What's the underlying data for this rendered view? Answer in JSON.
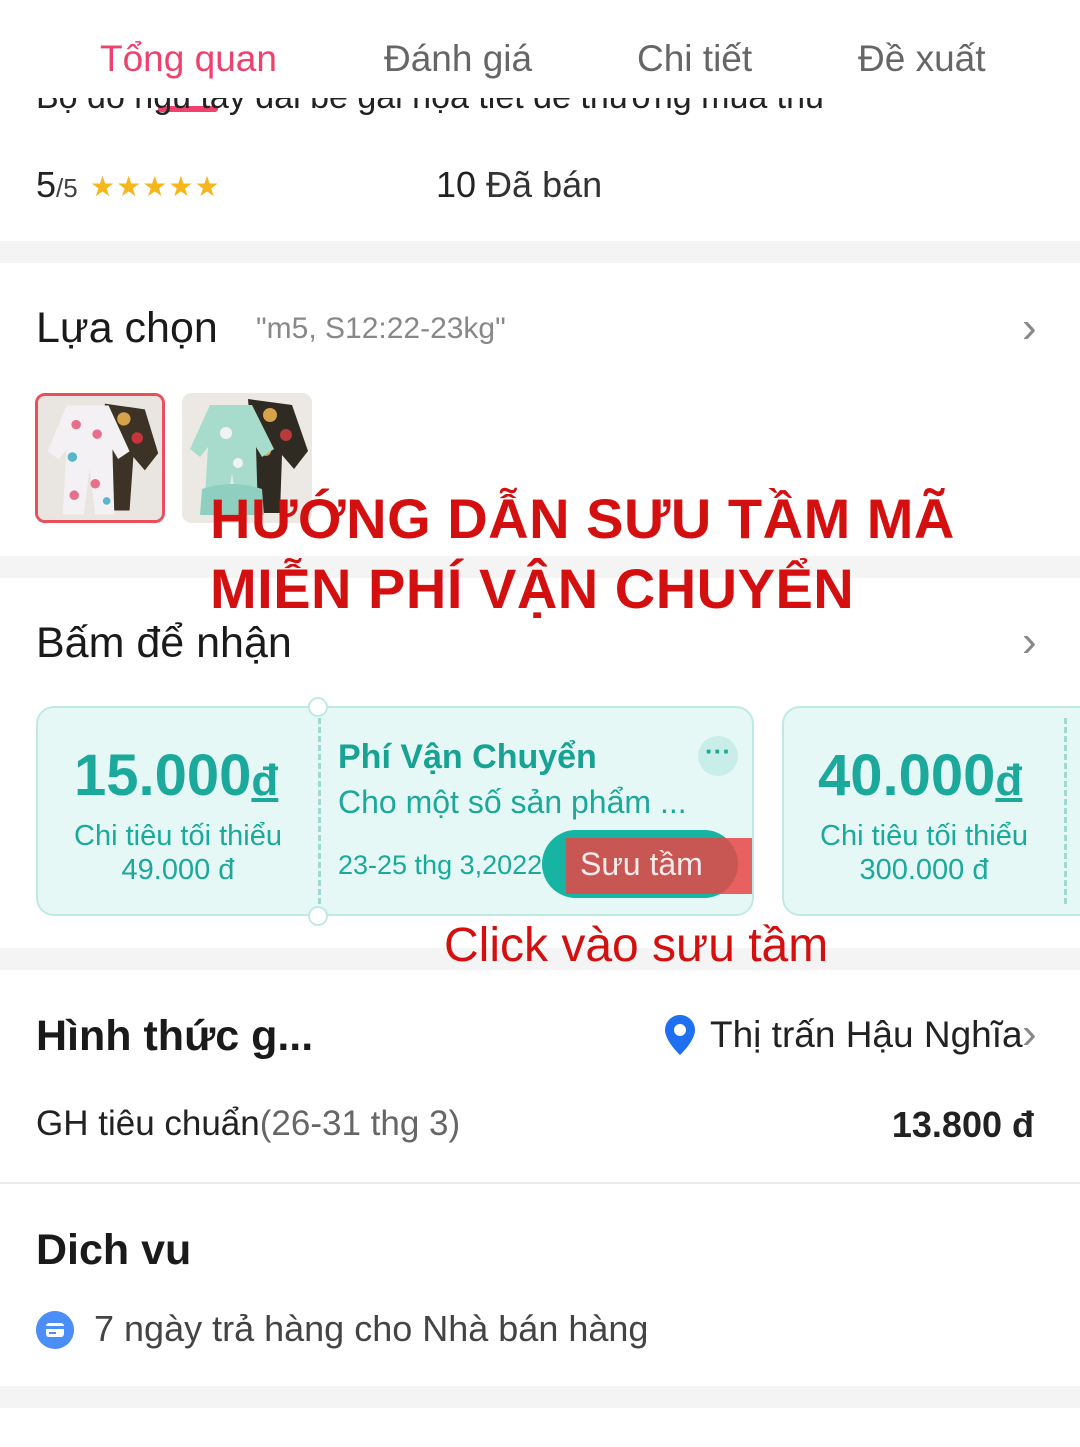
{
  "tabs": [
    {
      "label": "Tổng quan",
      "active": true
    },
    {
      "label": "Đánh giá",
      "active": false
    },
    {
      "label": "Chi tiết",
      "active": false
    },
    {
      "label": "Đề xuất",
      "active": false
    }
  ],
  "product": {
    "title_clipped": "Bộ đồ ngủ tay dài bé gái họa tiết dễ thương mùa thu",
    "rating_value": "5",
    "rating_max": "/5",
    "rating_stars": 5,
    "sold_count": "10",
    "sold_label": "Đã bán"
  },
  "selection": {
    "title": "Lựa chọn",
    "value": "\"m5, S12:22-23kg\"",
    "selected_index": 0
  },
  "overlay_text": {
    "line1": "HƯỚNG DẪN SƯU TẦM MÃ",
    "line2": "MIỄN PHÍ VẬN CHUYỂN",
    "note": "Click vào sưu tầm"
  },
  "vouchers": {
    "title": "Bấm để nhận",
    "items": [
      {
        "amount": "15.000",
        "currency": "đ",
        "min_label": "Chi tiêu tối thiểu",
        "min_value": "49.000 đ"
      },
      {
        "title": "Phí Vận Chuyển",
        "desc": "Cho một số sản phẩm ...",
        "date": "23-25 thg 3,2022",
        "more": "···",
        "button": "Sưu tầm"
      },
      {
        "amount": "40.000",
        "currency": "đ",
        "min_label": "Chi tiêu tối thiểu",
        "min_value": "300.000 đ"
      }
    ]
  },
  "delivery": {
    "title": "Hình thức g...",
    "location": "Thị trấn Hậu Nghĩa",
    "method": "GH tiêu chuẩn",
    "eta": "(26-31 thg 3)",
    "price": "13.800 đ"
  },
  "service": {
    "title": "Dich vu",
    "item": "7 ngày trả hàng cho Nhà bán hàng"
  },
  "colors": {
    "accent": "#f0416c",
    "teal": "#1aa99b",
    "overlay_red": "#d40f0f",
    "star": "#f5b71b"
  }
}
